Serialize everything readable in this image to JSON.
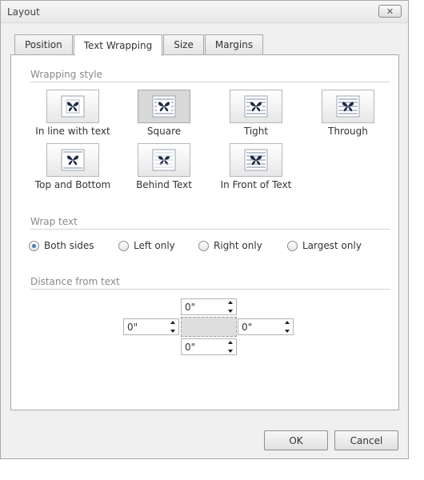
{
  "dialog": {
    "title": "Layout",
    "close_label": "✕"
  },
  "tabs": [
    {
      "label": "Position",
      "active": false
    },
    {
      "label": "Text Wrapping",
      "active": true
    },
    {
      "label": "Size",
      "active": false
    },
    {
      "label": "Margins",
      "active": false
    }
  ],
  "wrapping_style": {
    "heading": "Wrapping style",
    "selected": "Square",
    "options": [
      {
        "label": "In line with text",
        "icon": "wrap-inline-icon"
      },
      {
        "label": "Square",
        "icon": "wrap-square-icon"
      },
      {
        "label": "Tight",
        "icon": "wrap-tight-icon"
      },
      {
        "label": "Through",
        "icon": "wrap-through-icon"
      },
      {
        "label": "Top and Bottom",
        "icon": "wrap-top-bottom-icon"
      },
      {
        "label": "Behind Text",
        "icon": "wrap-behind-icon"
      },
      {
        "label": "In Front of Text",
        "icon": "wrap-front-icon"
      }
    ]
  },
  "wrap_text": {
    "heading": "Wrap text",
    "selected": "Both sides",
    "options": [
      {
        "label": "Both sides"
      },
      {
        "label": "Left only"
      },
      {
        "label": "Right only"
      },
      {
        "label": "Largest only"
      }
    ]
  },
  "distance": {
    "heading": "Distance from text",
    "top": "0\"",
    "left": "0\"",
    "right": "0\"",
    "bottom": "0\""
  },
  "footer": {
    "ok_label": "OK",
    "cancel_label": "Cancel"
  },
  "colors": {
    "accent": "#4a7ebb",
    "butterfly": "#1c2a44"
  }
}
